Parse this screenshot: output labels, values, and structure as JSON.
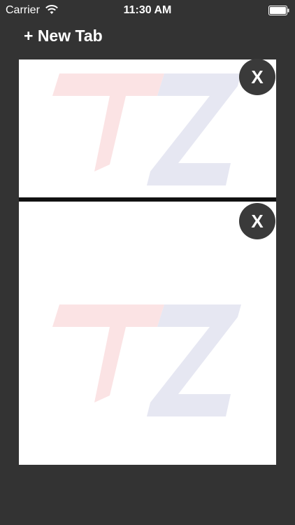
{
  "status_bar": {
    "carrier": "Carrier",
    "time": "11:30 AM",
    "wifi_icon": "wifi-icon",
    "battery_icon": "battery-icon"
  },
  "toolbar": {
    "new_tab_label": "+ New Tab"
  },
  "tabs": [
    {
      "logo_icon": "tz-logo-icon",
      "close_label": "X"
    },
    {
      "logo_icon": "tz-logo-icon",
      "close_label": "X"
    }
  ],
  "colors": {
    "background": "#333333",
    "tab_background": "#ffffff",
    "separator": "#111111",
    "close_button": "#3a3a3a",
    "logo_t": "#fbe3e4",
    "logo_z": "#e6e7f2"
  }
}
